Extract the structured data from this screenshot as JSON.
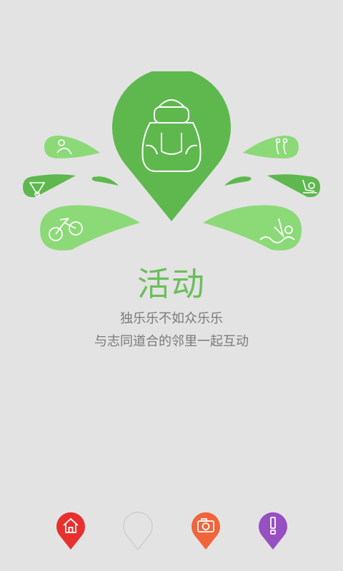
{
  "screen": {
    "title": "活动",
    "subtitle_line1": "独乐乐不如众乐乐",
    "subtitle_line2": "与志同道合的邻里一起互动"
  },
  "hero": {
    "center_icon": "backpack-icon",
    "left_drops": [
      "hiking-icon",
      "badminton-icon",
      "bicycle-icon"
    ],
    "right_drops": [
      "bowling-icon",
      "skating-icon",
      "swimming-icon"
    ]
  },
  "bottom_nav": [
    {
      "name": "home",
      "icon": "home-icon",
      "color": "#e8302e"
    },
    {
      "name": "activity",
      "icon": "blank-pin-icon",
      "color": "#d0d0d0"
    },
    {
      "name": "camera",
      "icon": "camera-icon",
      "color": "#f2643a"
    },
    {
      "name": "alert",
      "icon": "exclamation-icon",
      "color": "#9650c1"
    }
  ],
  "colors": {
    "background": "#e3e3e3",
    "green_dark": "#5eb84e",
    "green_light": "#8cd978",
    "title_green": "#6cbe5c",
    "text_gray": "#7a7a7a"
  }
}
